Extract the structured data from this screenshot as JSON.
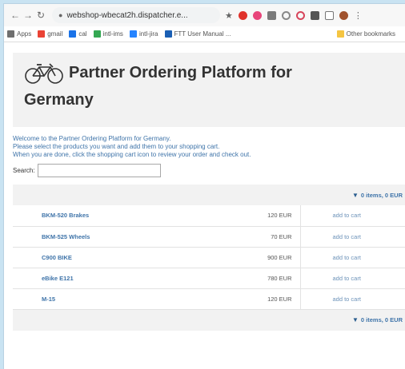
{
  "browser": {
    "url": "webshop-wbecat2h.dispatcher.e...",
    "bookmarks": [
      {
        "label": "Apps",
        "color": "#6f6f6f"
      },
      {
        "label": "gmail",
        "color": "#ea4335"
      },
      {
        "label": "cal",
        "color": "#1a73e8"
      },
      {
        "label": "intl-ims",
        "color": "#34a853"
      },
      {
        "label": "intl-jira",
        "color": "#2684ff"
      },
      {
        "label": "FTT User Manual ...",
        "color": "#1a5fb4"
      }
    ],
    "other_bookmarks": "Other bookmarks"
  },
  "page": {
    "title_line1": "Partner Ordering Platform for",
    "title_line2": "Germany",
    "intro": [
      "Welcome to the Partner Ordering Platform for Germany.",
      "Please select the products you want and add them to your shopping cart.",
      "When you are done, click the shopping cart icon to review your order and check out."
    ],
    "search_label": "Search:",
    "search_value": "",
    "cart_summary": "0 items, 0 EUR",
    "products": [
      {
        "name": "BKM-520 Brakes",
        "price": "120 EUR",
        "action": "add to cart"
      },
      {
        "name": "BKM-525 Wheels",
        "price": "70 EUR",
        "action": "add to cart"
      },
      {
        "name": "C900 BIKE",
        "price": "900 EUR",
        "action": "add to cart"
      },
      {
        "name": "eBike E121",
        "price": "780 EUR",
        "action": "add to cart"
      },
      {
        "name": "M-15",
        "price": "120 EUR",
        "action": "add to cart"
      }
    ]
  },
  "colors": {
    "link": "#3f74a9",
    "header_bg": "#f2f2f2",
    "frame": "#c9e3f2"
  },
  "icons": [
    "back-icon",
    "forward-icon",
    "reload-icon",
    "lock-icon",
    "star-icon",
    "bike-logo-icon",
    "cart-icon"
  ]
}
